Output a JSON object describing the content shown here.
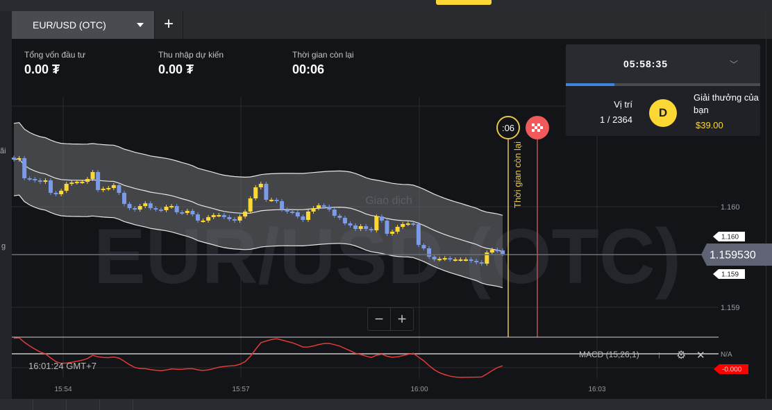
{
  "tab": {
    "asset": "EUR/USD (OTC)",
    "add_label": "+"
  },
  "left_edge": {
    "label1": "ãi",
    "label2": "g"
  },
  "stats": [
    {
      "label": "Tổng vốn đầu tư",
      "value": "0.00 ₮"
    },
    {
      "label": "Thu nhập dự kiến",
      "value": "0.00 ₮"
    },
    {
      "label": "Thời gian còn lại",
      "value": "00:06"
    }
  ],
  "tournament": {
    "timer": "05:58:35",
    "progress_percent": 25,
    "position_label": "Vị trí",
    "position_value": "1 / 2364",
    "avatar_letter": "D",
    "prize_label": "Giải thưởng của bạn",
    "prize_value": "$39.00"
  },
  "chart": {
    "watermark": "EUR/USD (OTC)",
    "trade_label": "Giao dịch",
    "timer_badge": ":06",
    "timer_vertical": "Thời gian còn lại",
    "current_price": "1.159530",
    "price_ticks": [
      "1.160",
      "1.159"
    ],
    "price_tags": {
      "upper": "1.160",
      "lower": "1.159"
    },
    "time_ticks": [
      "15:54",
      "15:57",
      "16:00",
      "16:03"
    ],
    "clock": "16:01:24 GMT+7",
    "zoom_out": "−",
    "zoom_in": "+",
    "macd_label": "MACD (15,26,1)",
    "macd_na": "N/A",
    "macd_value": "-0.000",
    "colors": {
      "up": "#fdd835",
      "down": "#7b9be8",
      "macd": "#e53935",
      "timer": "#e8c547",
      "finish": "#f05a5a"
    },
    "closes": [
      1.160469,
      1.160483,
      1.160283,
      1.160276,
      1.160262,
      1.160248,
      1.160262,
      1.160138,
      1.160124,
      1.160159,
      1.160228,
      1.160241,
      1.160248,
      1.160248,
      1.160276,
      1.160345,
      1.160166,
      1.160179,
      1.160186,
      1.160214,
      1.160138,
      1.160028,
      1.159986,
      1.159972,
      1.160007,
      1.160034,
      1.159986,
      1.159972,
      1.159966,
      1.16,
      1.160007,
      1.159945,
      1.159938,
      1.159959,
      1.159924,
      1.159862,
      1.159862,
      1.159897,
      1.159917,
      1.159917,
      1.159897,
      1.159876,
      1.159862,
      1.159903,
      1.159952,
      1.160083,
      1.160193,
      1.160228,
      1.160069,
      1.160069,
      1.160055,
      1.159972,
      1.159952,
      1.159945,
      1.159903,
      1.159869,
      1.159952,
      1.159986,
      1.160014,
      1.16,
      1.159972,
      1.15991,
      1.15989,
      1.159834,
      1.159814,
      1.159779,
      1.159807,
      1.159779,
      1.159765,
      1.159903,
      1.159862,
      1.159731,
      1.159752,
      1.1598,
      1.159828,
      1.159834,
      1.159828,
      1.15962,
      1.159586,
      1.159503,
      1.159476,
      1.159482,
      1.159489,
      1.159476,
      1.159476,
      1.159476,
      1.159476,
      1.159462,
      1.159448,
      1.159434,
      1.159545,
      1.159572,
      1.159565,
      1.15953
    ]
  }
}
